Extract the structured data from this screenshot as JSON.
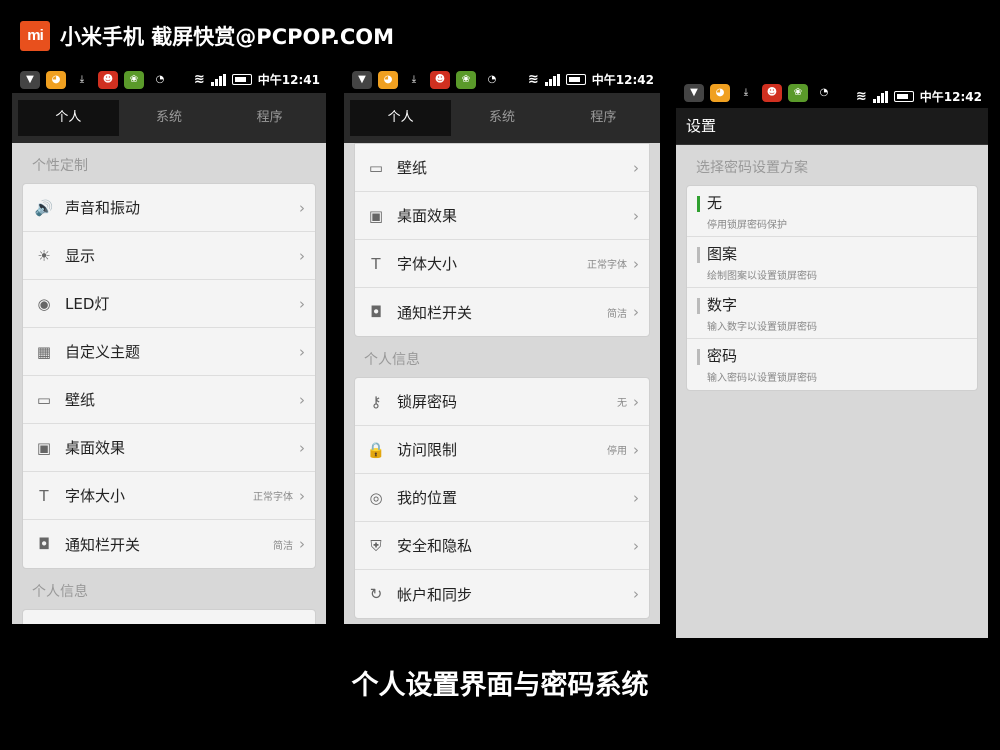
{
  "header": {
    "logo_text": "mi",
    "title": "小米手机 截屏快赏@PCPOP.COM"
  },
  "status": {
    "p1_time": "中午12:41",
    "p2_time": "中午12:42",
    "p3_time": "中午12:42"
  },
  "tabs": [
    "个人",
    "系统",
    "程序"
  ],
  "phone1": {
    "section1": "个性定制",
    "items": [
      {
        "icon": "speaker-icon",
        "glyph": "🔊",
        "label": "声音和振动",
        "value": ""
      },
      {
        "icon": "brightness-icon",
        "glyph": "☀",
        "label": "显示",
        "value": ""
      },
      {
        "icon": "led-icon",
        "glyph": "◉",
        "label": "LED灯",
        "value": ""
      },
      {
        "icon": "theme-icon",
        "glyph": "▦",
        "label": "自定义主题",
        "value": ""
      },
      {
        "icon": "wallpaper-icon",
        "glyph": "▭",
        "label": "壁纸",
        "value": ""
      },
      {
        "icon": "android-icon",
        "glyph": "▣",
        "label": "桌面效果",
        "value": ""
      },
      {
        "icon": "font-icon",
        "glyph": "T",
        "label": "字体大小",
        "value": "正常字体"
      },
      {
        "icon": "notification-icon",
        "glyph": "◘",
        "label": "通知栏开关",
        "value": "简洁"
      }
    ],
    "section2": "个人信息"
  },
  "phone2": {
    "items1": [
      {
        "icon": "wallpaper-icon",
        "glyph": "▭",
        "label": "壁纸",
        "value": ""
      },
      {
        "icon": "android-icon",
        "glyph": "▣",
        "label": "桌面效果",
        "value": ""
      },
      {
        "icon": "font-icon",
        "glyph": "T",
        "label": "字体大小",
        "value": "正常字体"
      },
      {
        "icon": "notification-icon",
        "glyph": "◘",
        "label": "通知栏开关",
        "value": "简洁"
      }
    ],
    "section2": "个人信息",
    "items2": [
      {
        "icon": "key-icon",
        "glyph": "⚷",
        "label": "锁屏密码",
        "value": "无"
      },
      {
        "icon": "lock-icon",
        "glyph": "🔒",
        "label": "访问限制",
        "value": "停用"
      },
      {
        "icon": "location-icon",
        "glyph": "◎",
        "label": "我的位置",
        "value": ""
      },
      {
        "icon": "shield-icon",
        "glyph": "⛨",
        "label": "安全和隐私",
        "value": ""
      },
      {
        "icon": "sync-icon",
        "glyph": "↻",
        "label": "帐户和同步",
        "value": ""
      }
    ]
  },
  "phone3": {
    "title": "设置",
    "section": "选择密码设置方案",
    "options": [
      {
        "title": "无",
        "sub": "停用锁屏密码保护",
        "selected": true
      },
      {
        "title": "图案",
        "sub": "绘制图案以设置锁屏密码",
        "selected": false
      },
      {
        "title": "数字",
        "sub": "输入数字以设置锁屏密码",
        "selected": false
      },
      {
        "title": "密码",
        "sub": "输入密码以设置锁屏密码",
        "selected": false
      }
    ]
  },
  "caption": "个人设置界面与密码系统",
  "colors": {
    "accent": "#e8501d",
    "selected": "#30a030"
  }
}
